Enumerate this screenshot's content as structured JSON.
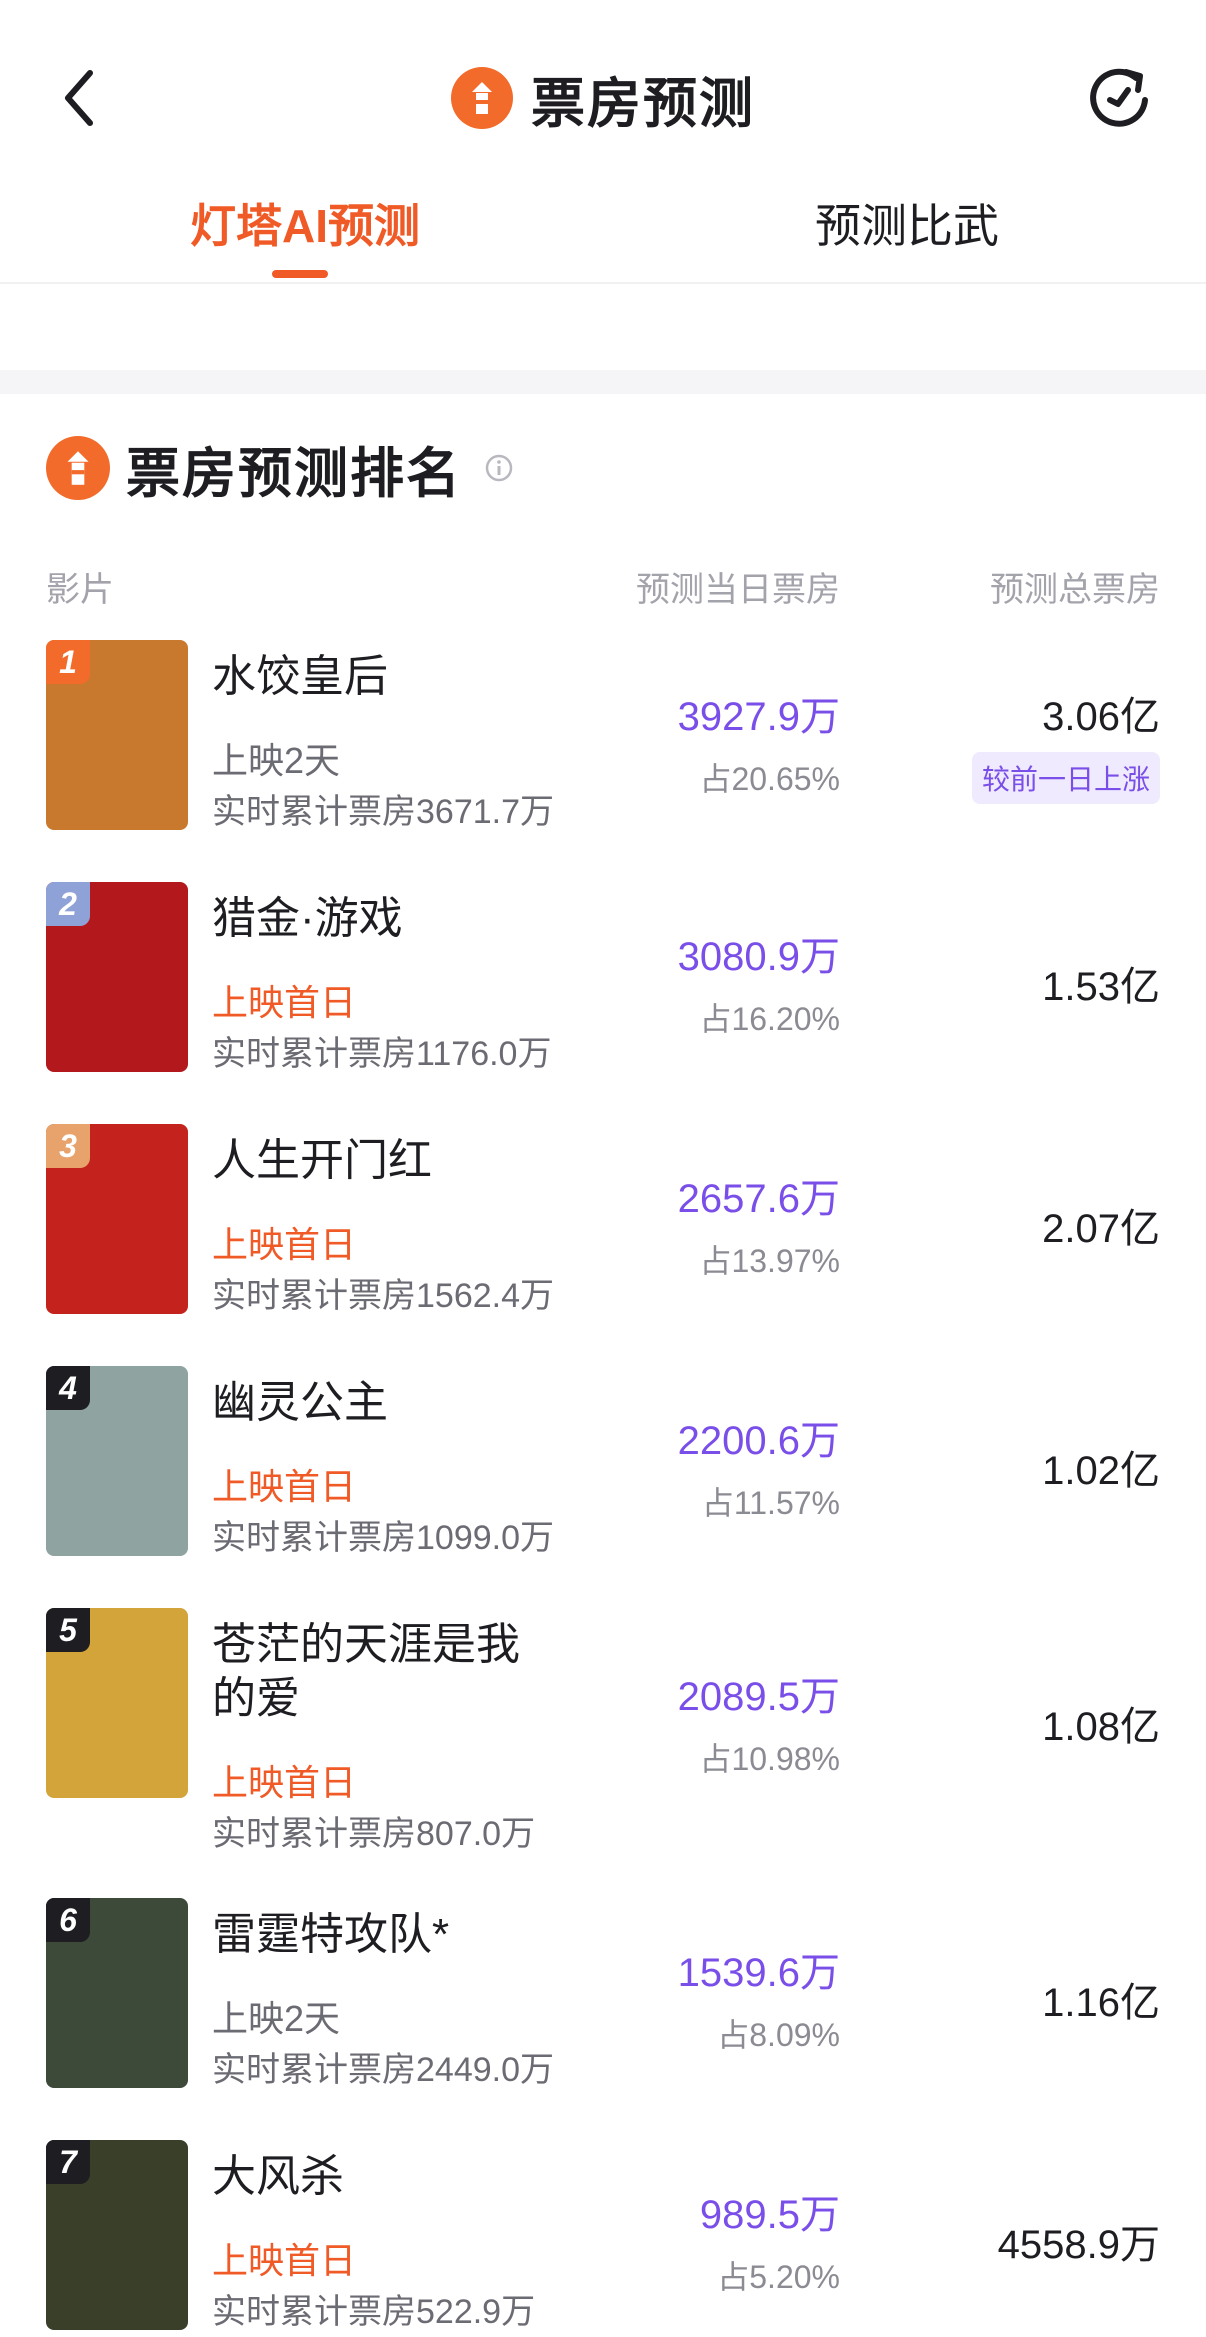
{
  "header": {
    "title": "票房预测",
    "back_icon": "chevron-left-icon",
    "refresh_icon": "refresh-icon"
  },
  "tabs": [
    {
      "label": "灯塔AI预测",
      "active": true
    },
    {
      "label": "预测比武",
      "active": false
    }
  ],
  "section": {
    "title": "票房预测排名",
    "info_icon": "info-icon"
  },
  "columns": {
    "film": "影片",
    "daily": "预测当日票房",
    "total": "预测总票房"
  },
  "films": [
    {
      "rank": "1",
      "name": "水饺皇后",
      "status": "上映2天",
      "cumulative": "实时累计票房3671.7万",
      "daily": "3927.9万",
      "share": "占20.65%",
      "total": "3.06亿",
      "badge": "较前一日上涨",
      "rank_color": "#f26b2b",
      "poster_color": "#c9792e"
    },
    {
      "rank": "2",
      "name": "猎金·游戏",
      "status": "上映首日",
      "cumulative": "实时累计票房1176.0万",
      "daily": "3080.9万",
      "share": "占16.20%",
      "total": "1.53亿",
      "rank_color": "#8fa2d8",
      "poster_color": "#b3181c"
    },
    {
      "rank": "3",
      "name": "人生开门红",
      "status": "上映首日",
      "cumulative": "实时累计票房1562.4万",
      "daily": "2657.6万",
      "share": "占13.97%",
      "total": "2.07亿",
      "rank_color": "#e8a36c",
      "poster_color": "#c3221d"
    },
    {
      "rank": "4",
      "name": "幽灵公主",
      "status": "上映首日",
      "cumulative": "实时累计票房1099.0万",
      "daily": "2200.6万",
      "share": "占11.57%",
      "total": "1.02亿",
      "rank_color": "#1d1d22",
      "poster_color": "#8fa3a0"
    },
    {
      "rank": "5",
      "name": "苍茫的天涯是我的爱",
      "status": "上映首日",
      "cumulative": "实时累计票房807.0万",
      "daily": "2089.5万",
      "share": "占10.98%",
      "total": "1.08亿",
      "rank_color": "#1d1d22",
      "poster_color": "#d2a43a"
    },
    {
      "rank": "6",
      "name": "雷霆特攻队*",
      "status": "上映2天",
      "cumulative": "实时累计票房2449.0万",
      "daily": "1539.6万",
      "share": "占8.09%",
      "total": "1.16亿",
      "rank_color": "#1d1d22",
      "poster_color": "#3d4a3a"
    },
    {
      "rank": "7",
      "name": "大风杀",
      "status": "上映首日",
      "cumulative": "实时累计票房522.9万",
      "daily": "989.5万",
      "share": "占5.20%",
      "total": "4558.9万",
      "rank_color": "#1d1d22",
      "poster_color": "#3a3f2a"
    }
  ]
}
